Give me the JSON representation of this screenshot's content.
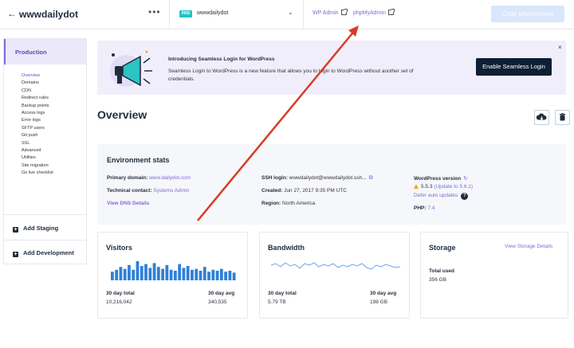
{
  "topbar": {
    "site_title": "wwwdailydot",
    "more_icon": "more-horizontal-icon",
    "env_badge": "PRD",
    "env_name": "wwwdailydot",
    "wp_admin_label": "WP Admin",
    "phpmyadmin_label": "phpMyAdmin",
    "copy_env_label": "Copy environment"
  },
  "sidebar": {
    "production_label": "Production",
    "items": [
      "Overview",
      "Domains",
      "CDN",
      "Redirect rules",
      "Backup points",
      "Access logs",
      "Error logs",
      "SFTP users",
      "Git push",
      "SSL",
      "Advanced",
      "Utilities",
      "Site migration",
      "Go live checklist"
    ],
    "add_staging_label": "Add Staging",
    "add_development_label": "Add Development"
  },
  "banner": {
    "title": "Introducing Seamless Login for WordPress",
    "text": "Seamless Login to WordPress is a new feature that allows you to login to WordPress without another set of credentials.",
    "button_label": "Enable Seamless Login",
    "close_label": "×"
  },
  "overview": {
    "title": "Overview"
  },
  "stats": {
    "title": "Environment stats",
    "primary_domain_label": "Primary domain:",
    "primary_domain_value": "www.dailydot.com",
    "technical_contact_label": "Technical contact:",
    "technical_contact_value": "Systems Admin",
    "dns_link": "View DNS Details",
    "ssh_login_label": "SSH login:",
    "ssh_login_value": "wwwdailydot@wwwdailydot.ssh...",
    "created_label": "Created:",
    "created_value": "Jun 27, 2017 9:35 PM UTC",
    "region_label": "Region:",
    "region_value": "North America",
    "wp_version_label": "WordPress version",
    "wp_version_value": "5.5.3",
    "wp_update_value": "(Update to 5.6.1)",
    "auto_updates_link": "Defer auto updates",
    "php_label": "PHP:",
    "php_value": "7.4"
  },
  "visitors": {
    "title": "Visitors",
    "total_label": "30 day total",
    "total_value": "10,216,042",
    "avg_label": "30 day avg",
    "avg_value": "340,535",
    "bar_values": [
      0.45,
      0.55,
      0.7,
      0.6,
      0.8,
      0.55,
      1.0,
      0.75,
      0.85,
      0.65,
      0.9,
      0.7,
      0.6,
      0.8,
      0.55,
      0.5,
      0.85,
      0.65,
      0.75,
      0.55,
      0.6,
      0.5,
      0.7,
      0.45,
      0.55,
      0.5,
      0.6,
      0.45,
      0.5,
      0.4
    ],
    "bar_color": "#2f80d8"
  },
  "bandwidth": {
    "title": "Bandwidth",
    "total_label": "30 day total",
    "total_value": "5.79 TB",
    "avg_label": "30 day avg",
    "avg_value": "198 GB",
    "line_color": "#6aa6e8"
  },
  "storage": {
    "title": "Storage",
    "details_link": "View Storage Details",
    "total_label": "Total used",
    "total_value": "356 GB"
  },
  "colors": {
    "accent": "#7e6bd6",
    "dark": "#0d1f35",
    "annotation_arrow": "#d93a26"
  }
}
